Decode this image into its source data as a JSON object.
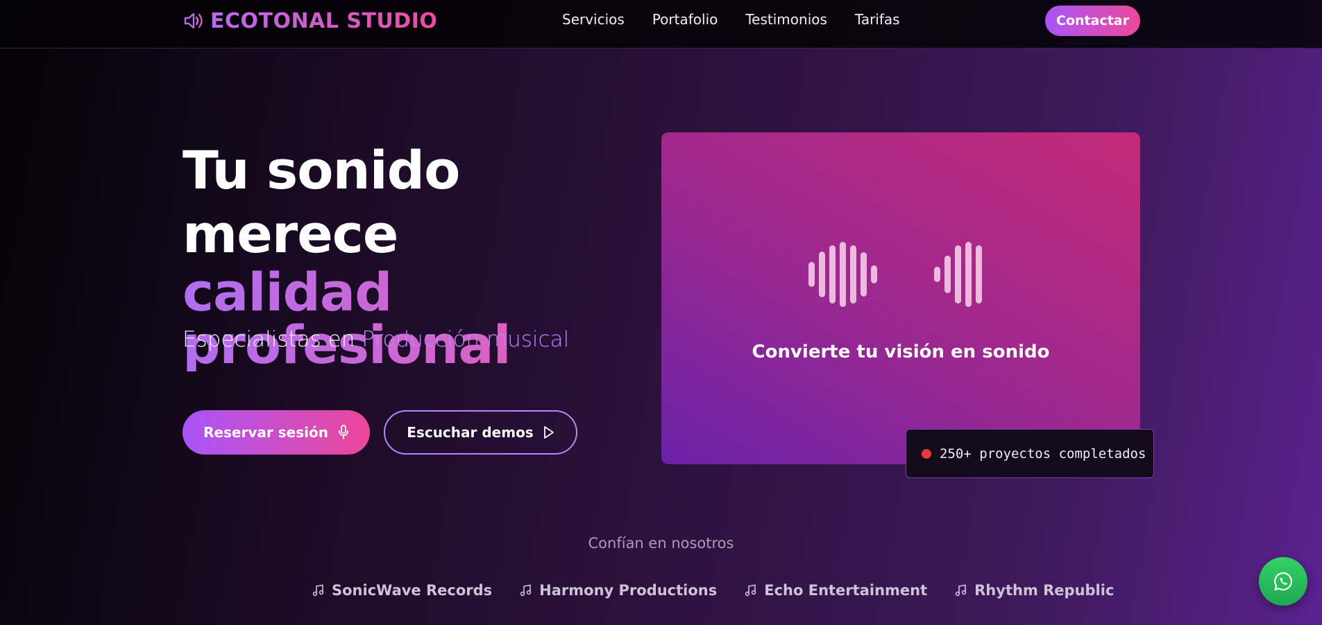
{
  "header": {
    "brand": "ECOTONAL STUDIO",
    "brand_icon": "speaker-icon",
    "nav": [
      {
        "label": "Servicios"
      },
      {
        "label": "Portafolio"
      },
      {
        "label": "Testimonios"
      },
      {
        "label": "Tarifas"
      }
    ],
    "contact_label": "Contactar"
  },
  "hero": {
    "title_line1": "Tu sonido merece",
    "title_line2": "calidad",
    "title_line3": "profesional",
    "subtitle_prefix": "Especialistas en",
    "subtitle_highlight": "Producción musical",
    "primary_button": "Reservar sesión",
    "primary_icon": "microphone-icon",
    "secondary_button": "Escuchar demos",
    "secondary_icon": "play-icon"
  },
  "visual": {
    "caption": "Convierte tu visión en sonido",
    "badge_text": "250+ proyectos completados",
    "badge_color": "#e23a3a"
  },
  "trust": {
    "label": "Confían en nosotros",
    "partners": [
      {
        "name": "SonicWave Records",
        "icon": "music-note-icon"
      },
      {
        "name": "Harmony Productions",
        "icon": "music-note-icon"
      },
      {
        "name": "Echo Entertainment",
        "icon": "music-note-icon"
      },
      {
        "name": "Rhythm Republic",
        "icon": "music-note-icon"
      }
    ]
  },
  "colors": {
    "accent_purple": "#a855f7",
    "accent_pink": "#ec4899",
    "whatsapp_green": "#25d366"
  },
  "floating": {
    "whatsapp_icon": "whatsapp-icon"
  }
}
